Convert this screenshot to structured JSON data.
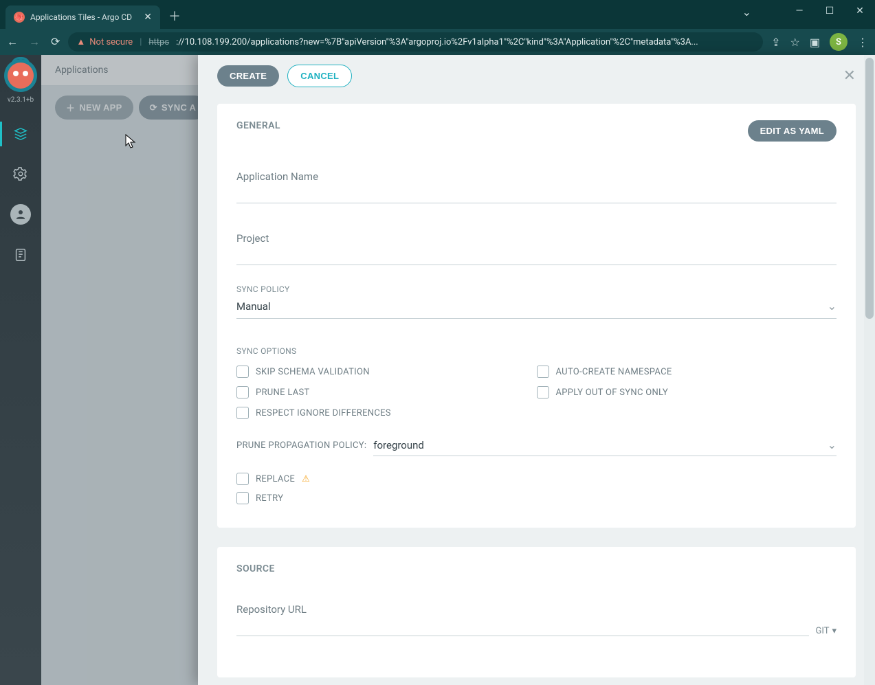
{
  "browser": {
    "tab_title": "Applications Tiles - Argo CD",
    "not_secure": "Not secure",
    "url_prefix": "https",
    "url_body": "://10.108.199.200/applications?new=%7B\"apiVersion\"%3A\"argoproj.io%2Fv1alpha1\"%2C\"kind\"%3A\"Application\"%2C\"metadata\"%3A...",
    "avatar_letter": "S"
  },
  "rail": {
    "version": "v2.3.1+b"
  },
  "header": {
    "title": "Applications"
  },
  "toolbar": {
    "new_app": "NEW APP",
    "sync_apps": "SYNC A"
  },
  "panel": {
    "create": "CREATE",
    "cancel": "CANCEL",
    "edit_yaml": "EDIT AS YAML",
    "sections": {
      "general": "GENERAL",
      "source": "SOURCE"
    },
    "fields": {
      "app_name": "Application Name",
      "project": "Project",
      "sync_policy_label": "SYNC POLICY",
      "sync_policy_value": "Manual",
      "sync_options_label": "SYNC OPTIONS",
      "prune_prop_label": "PRUNE PROPAGATION POLICY:",
      "prune_prop_value": "foreground",
      "repo_url": "Repository URL",
      "git": "GIT"
    },
    "options": {
      "skip_schema": "SKIP SCHEMA VALIDATION",
      "auto_ns": "AUTO-CREATE NAMESPACE",
      "prune_last": "PRUNE LAST",
      "out_of_sync": "APPLY OUT OF SYNC ONLY",
      "respect_ignore": "RESPECT IGNORE DIFFERENCES",
      "replace": "REPLACE",
      "retry": "RETRY"
    }
  }
}
